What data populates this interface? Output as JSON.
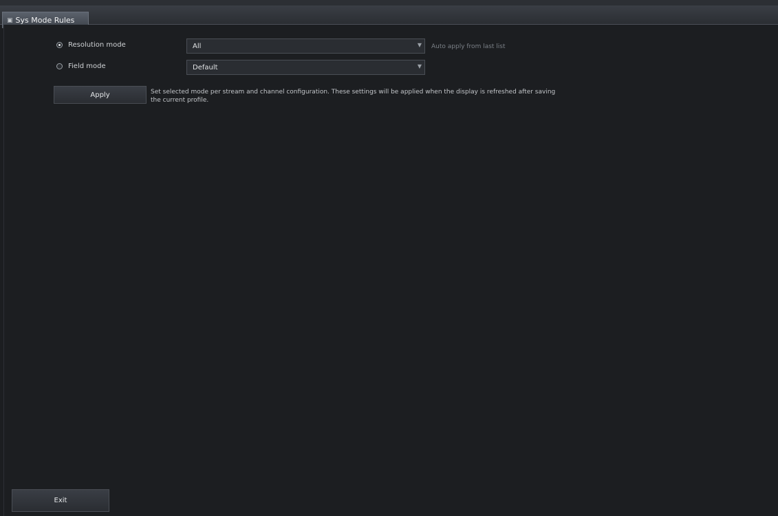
{
  "tab": {
    "label": "Sys Mode Rules",
    "icon": "monitor-icon"
  },
  "options": [
    {
      "label": "Resolution mode",
      "selected": true,
      "value": "All",
      "hint": "Auto apply from last list"
    },
    {
      "label": "Field mode",
      "selected": false,
      "value": "Default"
    }
  ],
  "apply_button": {
    "label": "Apply"
  },
  "description": "Set selected mode per stream and channel configuration. These settings will be applied when the display is refreshed after saving the current profile.",
  "exit_button": {
    "label": "Exit"
  },
  "colors": {
    "background": "#1c1e21",
    "tab_active": "#4a5059",
    "text": "#d8dadc"
  }
}
